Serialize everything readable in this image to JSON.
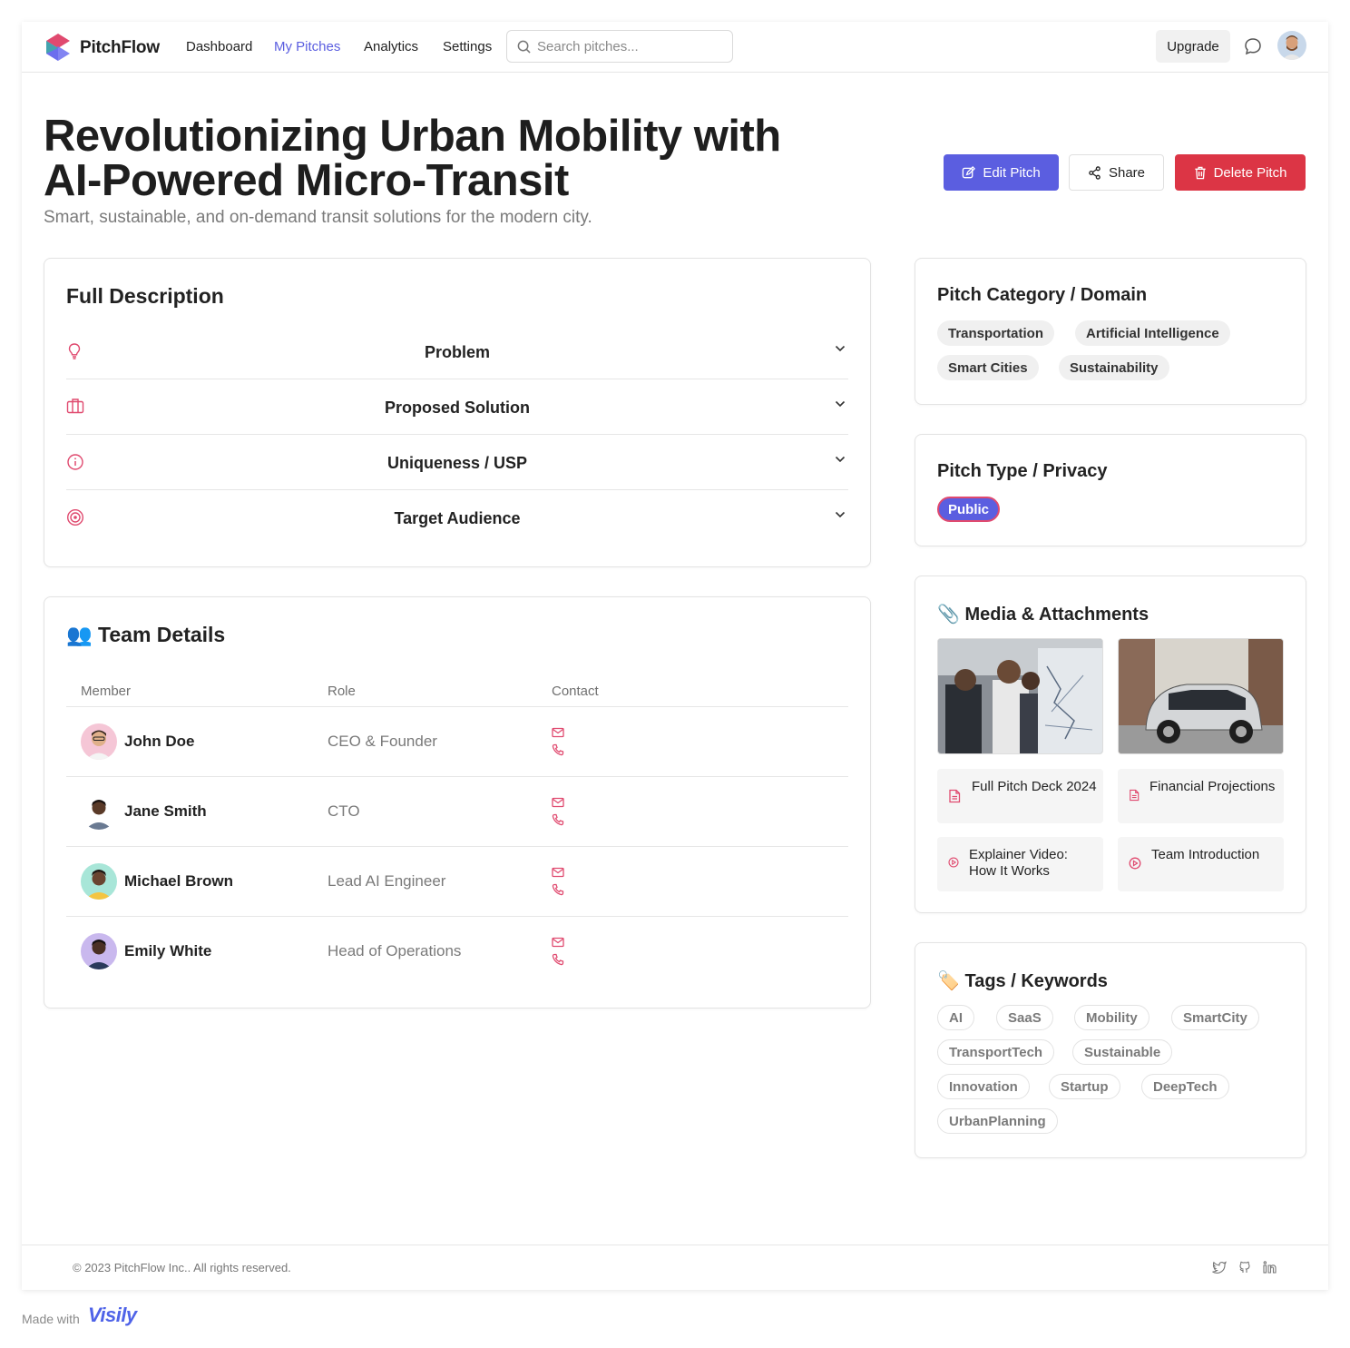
{
  "nav": {
    "brand": "PitchFlow",
    "links": [
      "Dashboard",
      "My Pitches",
      "Analytics",
      "Settings"
    ],
    "search_placeholder": "Search pitches...",
    "upgrade": "Upgrade"
  },
  "header": {
    "title": "Revolutionizing Urban Mobility with AI-Powered Micro-Transit",
    "subtitle": "Smart, sustainable, and on-demand transit solutions for the modern city.",
    "edit": "Edit Pitch",
    "share": "Share",
    "delete": "Delete Pitch"
  },
  "description": {
    "heading": "Full Description",
    "items": [
      "Problem",
      "Proposed Solution",
      "Uniqueness / USP",
      "Target Audience"
    ]
  },
  "team": {
    "heading": "👥 Team Details",
    "columns": [
      "Member",
      "Role",
      "Contact"
    ],
    "members": [
      {
        "name": "John Doe",
        "role": "CEO & Founder"
      },
      {
        "name": "Jane Smith",
        "role": "CTO"
      },
      {
        "name": "Michael Brown",
        "role": "Lead AI Engineer"
      },
      {
        "name": "Emily White",
        "role": "Head of Operations"
      }
    ]
  },
  "category": {
    "heading": "Pitch Category / Domain",
    "chips": [
      "Transportation",
      "Artificial Intelligence",
      "Smart Cities",
      "Sustainability"
    ]
  },
  "privacy": {
    "heading": "Pitch Type / Privacy",
    "value": "Public"
  },
  "media": {
    "heading": "📎 Media & Attachments",
    "attachments": [
      "Full Pitch Deck 2024",
      "Financial Projections",
      "Explainer Video: How It Works",
      "Team Introduction"
    ]
  },
  "tags": {
    "heading": "🏷️ Tags / Keywords",
    "items": [
      "AI",
      "SaaS",
      "Mobility",
      "SmartCity",
      "TransportTech",
      "Sustainable",
      "Innovation",
      "Startup",
      "DeepTech",
      "UrbanPlanning"
    ]
  },
  "footer": {
    "copyright": "© 2023 PitchFlow Inc.. All rights reserved.",
    "made_with": "Made with",
    "visily": "Visily"
  },
  "colors": {
    "accent": "#5b5ee0",
    "danger": "#dc3545",
    "icon_pink": "#e04a6f"
  }
}
